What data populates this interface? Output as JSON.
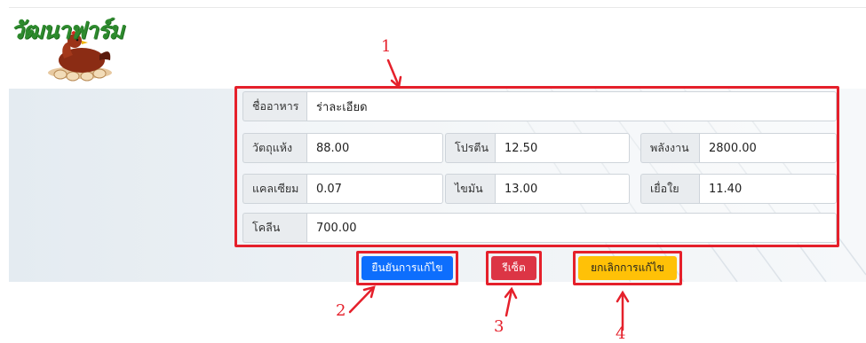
{
  "logo": {
    "text": "วัฒนาฟาร์ม"
  },
  "form": {
    "food_name": {
      "label": "ชื่ออาหาร",
      "value": "ร่าละเอียด"
    },
    "dry_matter": {
      "label": "วัตถุแห้ง",
      "value": "88.00"
    },
    "protein": {
      "label": "โปรตีน",
      "value": "12.50"
    },
    "energy": {
      "label": "พลังงาน",
      "value": "2800.00"
    },
    "calcium": {
      "label": "แคลเซียม",
      "value": "0.07"
    },
    "fat": {
      "label": "ไขมัน",
      "value": "13.00"
    },
    "fiber": {
      "label": "เยื่อใย",
      "value": "11.40"
    },
    "choline": {
      "label": "โคลีน",
      "value": "700.00"
    }
  },
  "buttons": {
    "confirm": "ยืนยันการแก้ไข",
    "reset": "รีเซ็ต",
    "cancel": "ยกเลิกการแก้ไข"
  },
  "annotations": [
    "1",
    "2",
    "3",
    "4"
  ],
  "colors": {
    "annotation_red": "#e5202b",
    "primary": "#0d6efd",
    "danger": "#dc3545",
    "warning": "#ffc107"
  }
}
